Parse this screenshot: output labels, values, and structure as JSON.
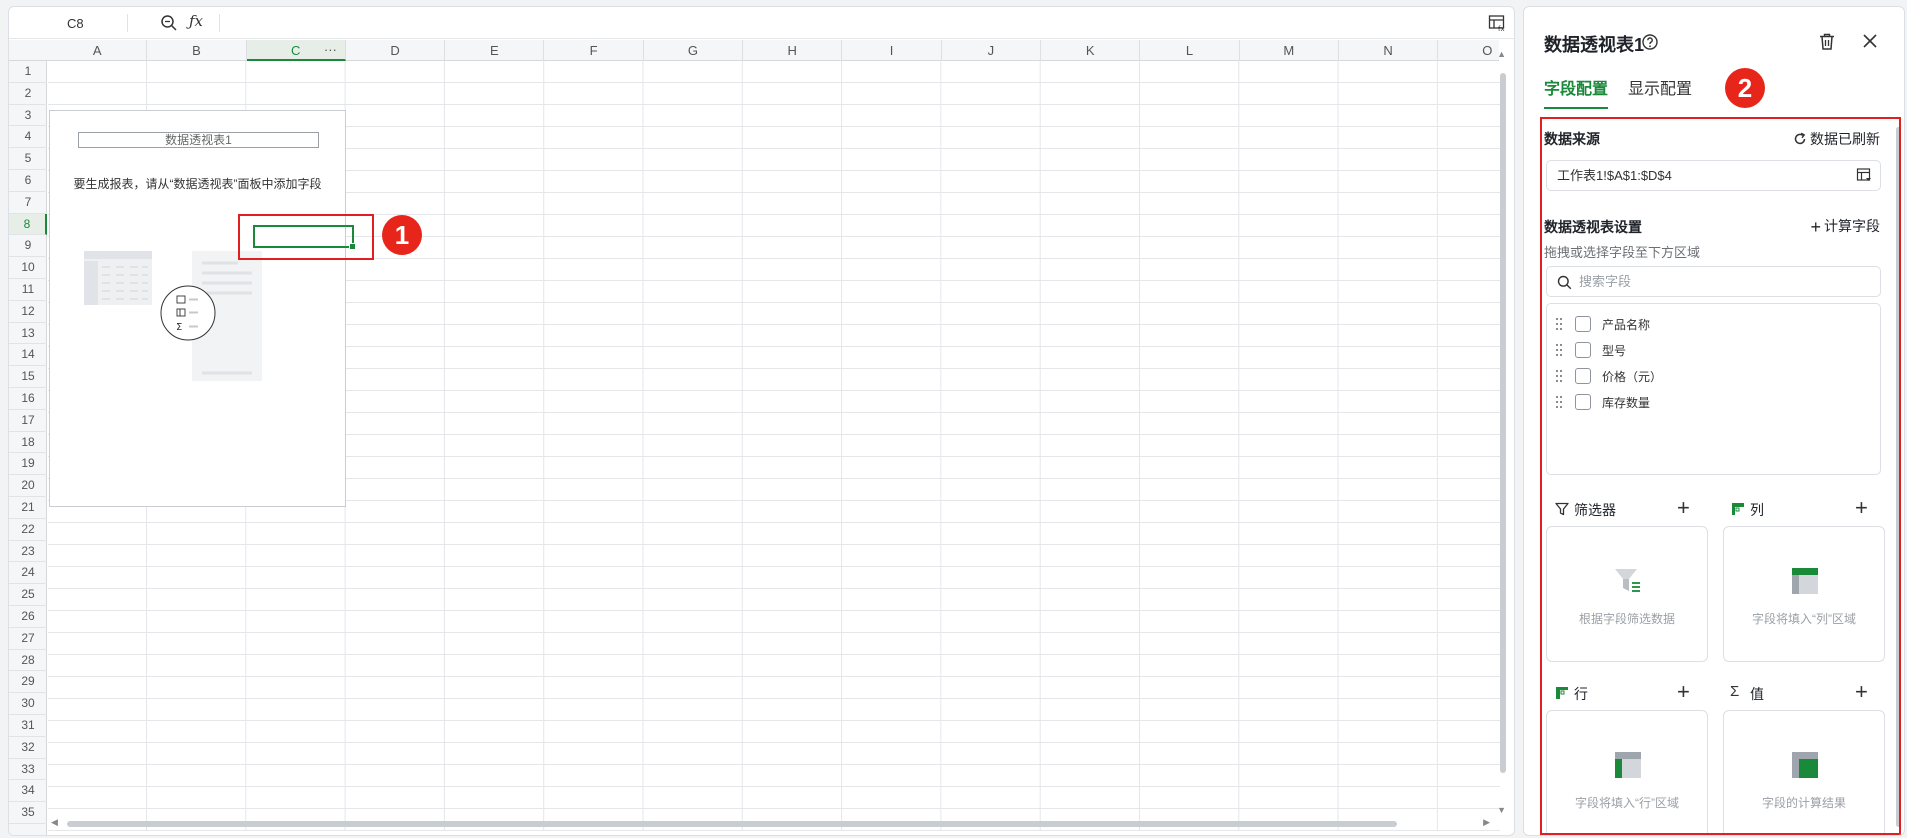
{
  "sheet": {
    "cell_ref": "C8",
    "columns": [
      "A",
      "B",
      "C",
      "D",
      "E",
      "F",
      "G",
      "H",
      "I",
      "J",
      "K",
      "L",
      "M",
      "N",
      "O"
    ],
    "selected_column": "C",
    "column_more": "···",
    "rows": [
      "1",
      "2",
      "3",
      "4",
      "5",
      "6",
      "7",
      "8",
      "9",
      "10",
      "11",
      "12",
      "13",
      "14",
      "15",
      "16",
      "17",
      "18",
      "19",
      "20",
      "21",
      "22",
      "23",
      "24",
      "25",
      "26",
      "27",
      "28",
      "29",
      "30",
      "31",
      "32",
      "33",
      "34",
      "35"
    ],
    "selected_row": "8",
    "pivot_placeholder": {
      "title": "数据透视表1",
      "hint": "要生成报表，请从“数据透视表”面板中添加字段"
    },
    "callout_1": "1",
    "icons": {
      "zoom": "zoom-out-icon",
      "formula": "function-icon",
      "panel_toggle": "pivot-panel-icon"
    },
    "fx_label": "ƒx"
  },
  "panel": {
    "title": "数据透视表1",
    "tabs": [
      {
        "label": "字段配置",
        "active": true
      },
      {
        "label": "显示配置",
        "active": false
      }
    ],
    "callout_2": "2",
    "data_source": {
      "title": "数据来源",
      "refresh_label": "数据已刷新",
      "range": "工作表1!$A$1:$D$4"
    },
    "settings": {
      "title": "数据透视表设置",
      "calc_field_label": "计算字段",
      "hint": "拖拽或选择字段至下方区域",
      "search_placeholder": "搜索字段"
    },
    "fields": [
      {
        "label": "产品名称",
        "checked": false
      },
      {
        "label": "型号",
        "checked": false
      },
      {
        "label": "价格（元）",
        "checked": false
      },
      {
        "label": "库存数量",
        "checked": false
      }
    ],
    "zones": {
      "filter": {
        "label": "筛选器",
        "placeholder": "根据字段筛选数据"
      },
      "columns": {
        "label": "列",
        "placeholder": "字段将填入“列”区域"
      },
      "rows": {
        "label": "行",
        "placeholder": "字段将填入“行”区域"
      },
      "values": {
        "label": "值",
        "placeholder": "字段的计算结果"
      }
    },
    "colors": {
      "accent": "#1a8a3a",
      "callout": "#e8251b"
    }
  }
}
